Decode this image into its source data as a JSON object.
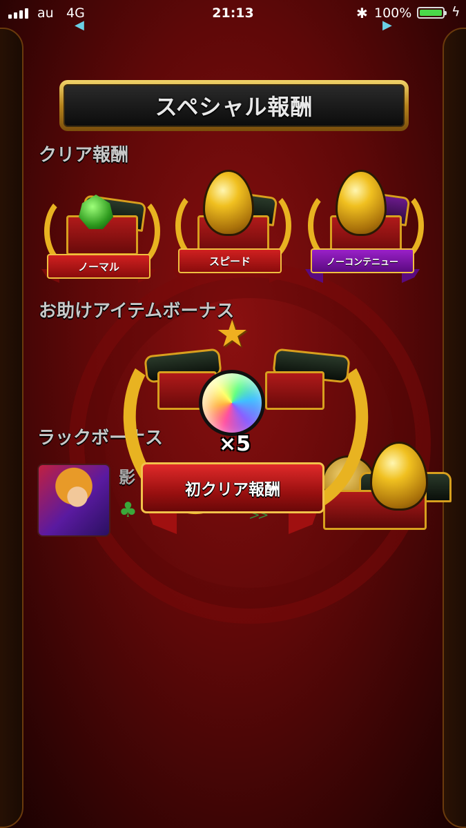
{
  "status_bar": {
    "carrier": "au",
    "network": "4G",
    "time": "21:13",
    "battery_percent": "100%",
    "battery_level": 1.0,
    "icons": [
      "signal-icon",
      "bluetooth-icon",
      "battery-icon",
      "charging-icon"
    ]
  },
  "header": {
    "title": "スペシャル報酬"
  },
  "clear_rewards": {
    "label": "クリア報酬",
    "items": [
      {
        "label": "ノーマル",
        "item": "gem-icon"
      },
      {
        "label": "スピード",
        "item": "egg-icon"
      },
      {
        "label": "ノーコンテニュー",
        "item": "egg-icon"
      }
    ]
  },
  "helper_bonus": {
    "label": "お助けアイテムボーナス"
  },
  "luck_bonus": {
    "label": "ラックボーナス",
    "name": "影"
  },
  "overlay": {
    "reward_item": "rainbow-orb-icon",
    "count": "×5",
    "title": "初クリア報酬"
  },
  "colors": {
    "background": "#5e0808",
    "gold": "#e8b321",
    "ribbon_red": "#d02020",
    "ribbon_purple": "#9a20c8"
  }
}
